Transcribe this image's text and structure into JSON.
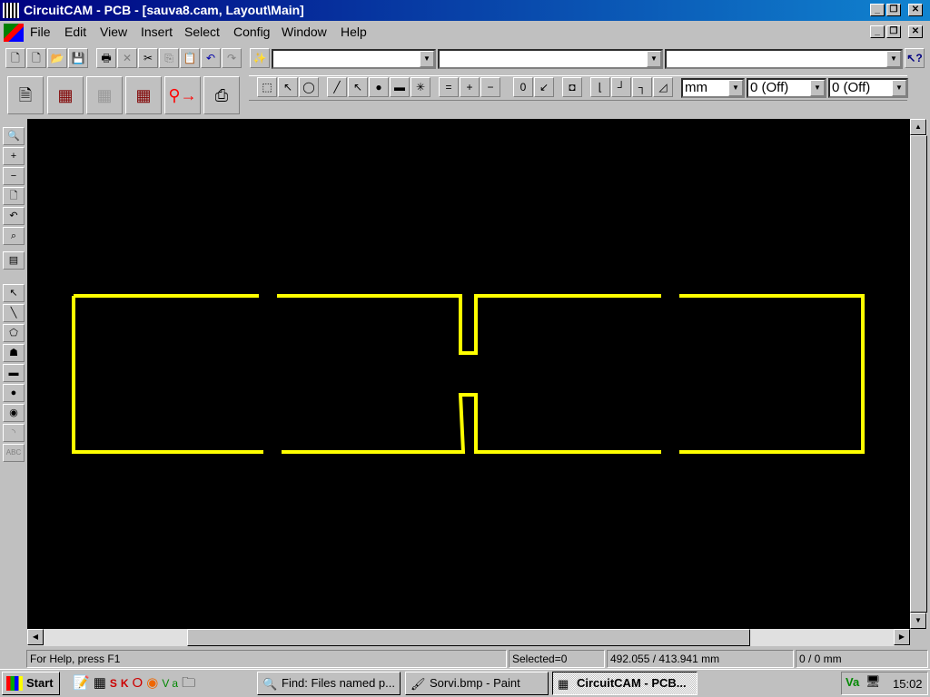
{
  "window": {
    "title": "CircuitCAM - PCB - [sauva8.cam, Layout\\Main]"
  },
  "menu": [
    "File",
    "Edit",
    "View",
    "Insert",
    "Select",
    "Config",
    "Window",
    "Help"
  ],
  "toolbar": {
    "combo1": "",
    "combo2": "",
    "combo3": "",
    "units": "mm",
    "grid1": "0 (Off)",
    "grid2": "0 (Off)"
  },
  "status": {
    "help": "For Help, press F1",
    "selected": "Selected=0",
    "coords": "492.055 / 413.941 mm",
    "delta": "0 / 0 mm"
  },
  "taskbar": {
    "start": "Start",
    "tasks": [
      "Find: Files named p...",
      "Sorvi.bmp - Paint",
      "CircuitCAM - PCB..."
    ],
    "clock": "15:02"
  },
  "colors": {
    "canvas": "#000000",
    "trace": "#ffff00",
    "titlebar": "#000080"
  }
}
